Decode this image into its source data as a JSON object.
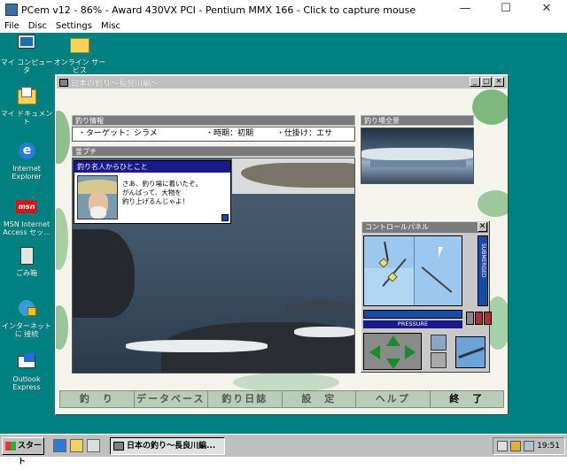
{
  "host": {
    "title": "PCem v12 - 86% - Award 430VX PCI - Pentium MMX 166 - Click to capture mouse",
    "menu": [
      "File",
      "Disc",
      "Settings",
      "Misc"
    ],
    "controls": {
      "minimize": "—",
      "maximize": "☐",
      "close": "✕"
    }
  },
  "desktop": {
    "icons": [
      {
        "label": "マイ コンピュータ",
        "icon": "my-computer-icon"
      },
      {
        "label": "オンライン サービス",
        "icon": "folder-icon"
      },
      {
        "label": "マイ ドキュメント",
        "icon": "my-documents-icon"
      },
      {
        "label": "Internet Explorer",
        "icon": "internet-explorer-icon"
      },
      {
        "label": "MSN Internet Access セッ...",
        "icon": "msn-icon"
      },
      {
        "label": "ごみ箱",
        "icon": "recycle-bin-icon"
      },
      {
        "label": "インターネットに 接続",
        "icon": "connect-internet-icon"
      },
      {
        "label": "Outlook Express",
        "icon": "outlook-express-icon"
      }
    ]
  },
  "game": {
    "title": "日本の釣り〜長良川編〜",
    "info_header": "釣り情報",
    "info": {
      "target": "・ターゲット：シラメ",
      "time": "・時期：初期",
      "tackle": "・仕掛け：エサ"
    },
    "spot_header": "釜ブチ",
    "scenic_header": "釣り場全景",
    "message": {
      "header": "釣り名人からひとこと",
      "lines": "さあ、釣り場に着いたぞ。\nがんばって、大物を\n釣り上げるんじゃよ！"
    },
    "control_panel": {
      "header": "コントロールパネル",
      "close": "✕",
      "submerged": "SUBMERGED",
      "pressure": "PRESSURE"
    },
    "menu": [
      "釣　り",
      "データベース",
      "釣り日誌",
      "設　定",
      "ヘルプ",
      "終　了"
    ]
  },
  "taskbar": {
    "start": "スタート",
    "task_label": "日本の釣り〜長良川編...",
    "clock": "19:51"
  },
  "colors": {
    "desktop": "#008080",
    "title_bar": "#c0c0c0",
    "message_header": "#1a1a8a",
    "menu_bar": "#b8ccb8"
  }
}
